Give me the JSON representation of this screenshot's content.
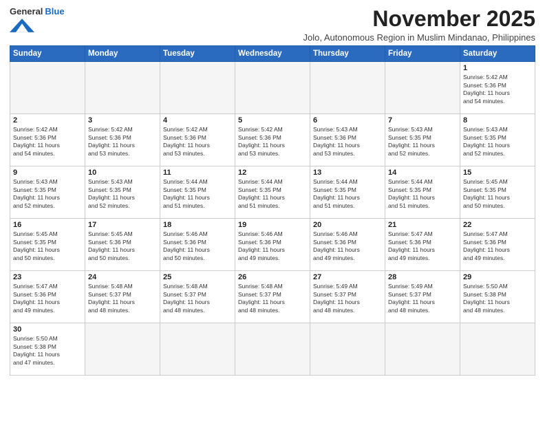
{
  "logo": {
    "general": "General",
    "blue": "Blue"
  },
  "title": "November 2025",
  "subtitle": "Jolo, Autonomous Region in Muslim Mindanao, Philippines",
  "weekdays": [
    "Sunday",
    "Monday",
    "Tuesday",
    "Wednesday",
    "Thursday",
    "Friday",
    "Saturday"
  ],
  "weeks": [
    [
      {
        "day": "",
        "info": ""
      },
      {
        "day": "",
        "info": ""
      },
      {
        "day": "",
        "info": ""
      },
      {
        "day": "",
        "info": ""
      },
      {
        "day": "",
        "info": ""
      },
      {
        "day": "",
        "info": ""
      },
      {
        "day": "1",
        "info": "Sunrise: 5:42 AM\nSunset: 5:36 PM\nDaylight: 11 hours\nand 54 minutes."
      }
    ],
    [
      {
        "day": "2",
        "info": "Sunrise: 5:42 AM\nSunset: 5:36 PM\nDaylight: 11 hours\nand 54 minutes."
      },
      {
        "day": "3",
        "info": "Sunrise: 5:42 AM\nSunset: 5:36 PM\nDaylight: 11 hours\nand 53 minutes."
      },
      {
        "day": "4",
        "info": "Sunrise: 5:42 AM\nSunset: 5:36 PM\nDaylight: 11 hours\nand 53 minutes."
      },
      {
        "day": "5",
        "info": "Sunrise: 5:42 AM\nSunset: 5:36 PM\nDaylight: 11 hours\nand 53 minutes."
      },
      {
        "day": "6",
        "info": "Sunrise: 5:43 AM\nSunset: 5:36 PM\nDaylight: 11 hours\nand 53 minutes."
      },
      {
        "day": "7",
        "info": "Sunrise: 5:43 AM\nSunset: 5:35 PM\nDaylight: 11 hours\nand 52 minutes."
      },
      {
        "day": "8",
        "info": "Sunrise: 5:43 AM\nSunset: 5:35 PM\nDaylight: 11 hours\nand 52 minutes."
      }
    ],
    [
      {
        "day": "9",
        "info": "Sunrise: 5:43 AM\nSunset: 5:35 PM\nDaylight: 11 hours\nand 52 minutes."
      },
      {
        "day": "10",
        "info": "Sunrise: 5:43 AM\nSunset: 5:35 PM\nDaylight: 11 hours\nand 52 minutes."
      },
      {
        "day": "11",
        "info": "Sunrise: 5:44 AM\nSunset: 5:35 PM\nDaylight: 11 hours\nand 51 minutes."
      },
      {
        "day": "12",
        "info": "Sunrise: 5:44 AM\nSunset: 5:35 PM\nDaylight: 11 hours\nand 51 minutes."
      },
      {
        "day": "13",
        "info": "Sunrise: 5:44 AM\nSunset: 5:35 PM\nDaylight: 11 hours\nand 51 minutes."
      },
      {
        "day": "14",
        "info": "Sunrise: 5:44 AM\nSunset: 5:35 PM\nDaylight: 11 hours\nand 51 minutes."
      },
      {
        "day": "15",
        "info": "Sunrise: 5:45 AM\nSunset: 5:35 PM\nDaylight: 11 hours\nand 50 minutes."
      }
    ],
    [
      {
        "day": "16",
        "info": "Sunrise: 5:45 AM\nSunset: 5:35 PM\nDaylight: 11 hours\nand 50 minutes."
      },
      {
        "day": "17",
        "info": "Sunrise: 5:45 AM\nSunset: 5:36 PM\nDaylight: 11 hours\nand 50 minutes."
      },
      {
        "day": "18",
        "info": "Sunrise: 5:46 AM\nSunset: 5:36 PM\nDaylight: 11 hours\nand 50 minutes."
      },
      {
        "day": "19",
        "info": "Sunrise: 5:46 AM\nSunset: 5:36 PM\nDaylight: 11 hours\nand 49 minutes."
      },
      {
        "day": "20",
        "info": "Sunrise: 5:46 AM\nSunset: 5:36 PM\nDaylight: 11 hours\nand 49 minutes."
      },
      {
        "day": "21",
        "info": "Sunrise: 5:47 AM\nSunset: 5:36 PM\nDaylight: 11 hours\nand 49 minutes."
      },
      {
        "day": "22",
        "info": "Sunrise: 5:47 AM\nSunset: 5:36 PM\nDaylight: 11 hours\nand 49 minutes."
      }
    ],
    [
      {
        "day": "23",
        "info": "Sunrise: 5:47 AM\nSunset: 5:36 PM\nDaylight: 11 hours\nand 49 minutes."
      },
      {
        "day": "24",
        "info": "Sunrise: 5:48 AM\nSunset: 5:37 PM\nDaylight: 11 hours\nand 48 minutes."
      },
      {
        "day": "25",
        "info": "Sunrise: 5:48 AM\nSunset: 5:37 PM\nDaylight: 11 hours\nand 48 minutes."
      },
      {
        "day": "26",
        "info": "Sunrise: 5:48 AM\nSunset: 5:37 PM\nDaylight: 11 hours\nand 48 minutes."
      },
      {
        "day": "27",
        "info": "Sunrise: 5:49 AM\nSunset: 5:37 PM\nDaylight: 11 hours\nand 48 minutes."
      },
      {
        "day": "28",
        "info": "Sunrise: 5:49 AM\nSunset: 5:37 PM\nDaylight: 11 hours\nand 48 minutes."
      },
      {
        "day": "29",
        "info": "Sunrise: 5:50 AM\nSunset: 5:38 PM\nDaylight: 11 hours\nand 48 minutes."
      }
    ],
    [
      {
        "day": "30",
        "info": "Sunrise: 5:50 AM\nSunset: 5:38 PM\nDaylight: 11 hours\nand 47 minutes."
      },
      {
        "day": "",
        "info": ""
      },
      {
        "day": "",
        "info": ""
      },
      {
        "day": "",
        "info": ""
      },
      {
        "day": "",
        "info": ""
      },
      {
        "day": "",
        "info": ""
      },
      {
        "day": "",
        "info": ""
      }
    ]
  ]
}
